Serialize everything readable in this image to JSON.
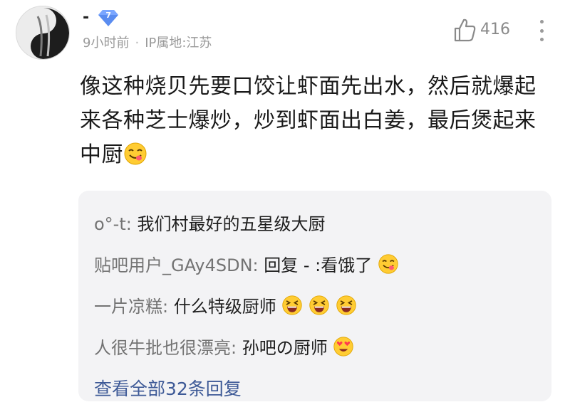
{
  "post": {
    "username": "-",
    "level": "7",
    "time": "9小时前",
    "separator": "·",
    "location": "IP属地:江苏",
    "like_count": "416",
    "content_parts": [
      "像这种烧贝先要口饺让虾面先出水，然后就爆起来各种芝士爆炒，炒到虾面出白姜，最后煲起来中厨"
    ],
    "content_emoji": "yum-emoji"
  },
  "replies": [
    {
      "author": "o°-t",
      "colon": ": ",
      "text": "我们村最好的五星级大厨",
      "emojis": []
    },
    {
      "author": "贴吧用户_GAy4SDN",
      "colon": ": ",
      "text": "回复 - :看饿了",
      "emojis": [
        "yum-emoji"
      ]
    },
    {
      "author": "一片凉糕",
      "colon": ": ",
      "text": "什么特级厨师",
      "emojis": [
        "grin-emoji",
        "grin-emoji",
        "grin-emoji"
      ]
    },
    {
      "author": "人很牛批也很漂亮",
      "colon": ": ",
      "text": "孙吧の厨师",
      "emojis": [
        "heart-eyes-emoji"
      ]
    }
  ],
  "view_all": "查看全部32条回复",
  "colors": {
    "link": "#3e5a97",
    "badge": "#5a8cf0",
    "meta": "#9a9a9a",
    "reply_bg": "#f3f3f5"
  }
}
